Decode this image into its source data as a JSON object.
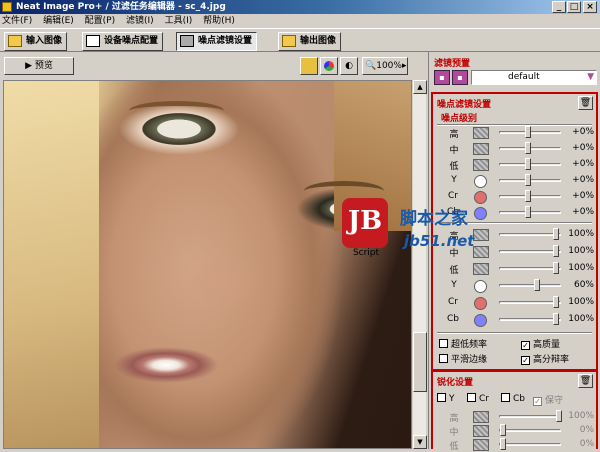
{
  "window": {
    "title": "Neat Image Pro+ / 过滤任务编辑器 - sc_4.jpg",
    "minimize": "_",
    "maximize": "□",
    "close": "×"
  },
  "menu": [
    "文件(F)",
    "编辑(E)",
    "配置(P)",
    "滤镜(I)",
    "工具(I)",
    "帮助(H)"
  ],
  "tabs": [
    {
      "label": "输入图像",
      "active": false
    },
    {
      "label": "设备噪点配置",
      "active": false
    },
    {
      "label": "噪点滤镜设置",
      "active": true
    },
    {
      "label": "输出图像",
      "active": false
    }
  ],
  "toolbar": {
    "preview": "预览",
    "zoom": "100%",
    "zoom_arrow": "▸"
  },
  "scrollbar": {
    "up": "▲",
    "down": "▼"
  },
  "panel": {
    "preset_header": "滤镜预置",
    "preset_value": "default",
    "preset_arrow": "▼",
    "noise_header": "噪点滤镜设置",
    "noise_level_header": "噪点级别",
    "noise_levels": [
      {
        "label": "高",
        "swatch": "texture",
        "value": "+0%",
        "knob": 0.45
      },
      {
        "label": "中",
        "swatch": "texture",
        "value": "+0%",
        "knob": 0.45
      },
      {
        "label": "低",
        "swatch": "texture",
        "value": "+0%",
        "knob": 0.45
      },
      {
        "label": "Y",
        "swatch": "#ffffff",
        "value": "+0%",
        "knob": 0.45
      },
      {
        "label": "Cr",
        "swatch": "#e07070",
        "value": "+0%",
        "knob": 0.45
      },
      {
        "label": "Cb",
        "swatch": "#8080ff",
        "value": "+0%",
        "knob": 0.45
      }
    ],
    "reduction_levels": [
      {
        "label": "高",
        "swatch": "texture",
        "value": "100%",
        "knob": 0.95
      },
      {
        "label": "中",
        "swatch": "texture",
        "value": "100%",
        "knob": 0.95
      },
      {
        "label": "低",
        "swatch": "texture",
        "value": "100%",
        "knob": 0.95
      },
      {
        "label": "Y",
        "swatch": "#ffffff",
        "value": "60%",
        "knob": 0.6
      },
      {
        "label": "Cr",
        "swatch": "#e07070",
        "value": "100%",
        "knob": 0.95
      },
      {
        "label": "Cb",
        "swatch": "#8080ff",
        "value": "100%",
        "knob": 0.95
      }
    ],
    "options": [
      {
        "label": "超低频率",
        "checked": false
      },
      {
        "label": "高质量",
        "checked": true
      },
      {
        "label": "平滑边缘",
        "checked": false
      },
      {
        "label": "高分辩率",
        "checked": true
      }
    ],
    "sharpen_header": "锐化设置",
    "sharpen_channels": [
      {
        "label": "Y",
        "checked": false
      },
      {
        "label": "Cr",
        "checked": false
      },
      {
        "label": "Cb",
        "checked": false
      },
      {
        "label": "保守",
        "checked": true
      }
    ],
    "sharpen_levels": [
      {
        "label": "高",
        "value": "100%"
      },
      {
        "label": "中",
        "value": "0%"
      },
      {
        "label": "低",
        "value": "0%"
      }
    ]
  },
  "watermark": {
    "logo": "JB",
    "script": "Script",
    "site_name": "脚本之家",
    "url": "jb51.net"
  }
}
